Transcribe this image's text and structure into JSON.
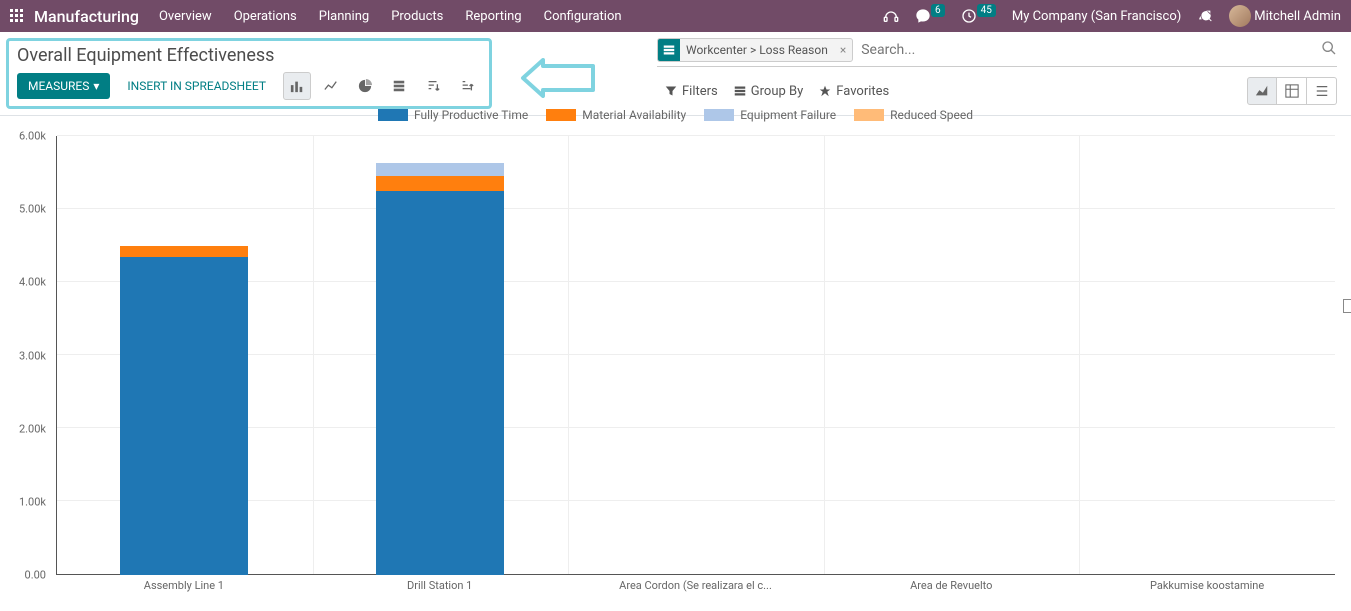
{
  "topnav": {
    "brand": "Manufacturing",
    "menu": [
      "Overview",
      "Operations",
      "Planning",
      "Products",
      "Reporting",
      "Configuration"
    ],
    "chat_badge": "6",
    "activity_badge": "45",
    "company": "My Company (San Francisco)",
    "user": "Mitchell Admin"
  },
  "cp": {
    "title": "Overall Equipment Effectiveness",
    "measures_label": "MEASURES",
    "spreadsheet_label": "INSERT IN SPREADSHEET"
  },
  "search": {
    "facet_label": "Workcenter > Loss Reason",
    "placeholder": "Search..."
  },
  "toolbar": {
    "filters": "Filters",
    "groupby": "Group By",
    "favorites": "Favorites"
  },
  "chart_data": {
    "type": "bar",
    "stacked": true,
    "ylabel": "",
    "ylim": [
      0,
      6000
    ],
    "yticks": [
      "0.00",
      "1.00k",
      "2.00k",
      "3.00k",
      "4.00k",
      "5.00k",
      "6.00k"
    ],
    "categories": [
      "Assembly Line 1",
      "Drill Station 1",
      "Area Cordon (Se realizara el c...",
      "Area de Revuelto",
      "Pakkumise koostamine"
    ],
    "series": [
      {
        "name": "Fully Productive Time",
        "color": "#1f77b4",
        "values": [
          4350,
          5250,
          0,
          0,
          0
        ]
      },
      {
        "name": "Material Availability",
        "color": "#ff7f0e",
        "values": [
          150,
          200,
          0,
          0,
          0
        ]
      },
      {
        "name": "Equipment Failure",
        "color": "#aec7e8",
        "values": [
          0,
          180,
          0,
          0,
          0
        ]
      },
      {
        "name": "Reduced Speed",
        "color": "#ffbb78",
        "values": [
          0,
          0,
          0,
          0,
          0
        ]
      }
    ]
  }
}
